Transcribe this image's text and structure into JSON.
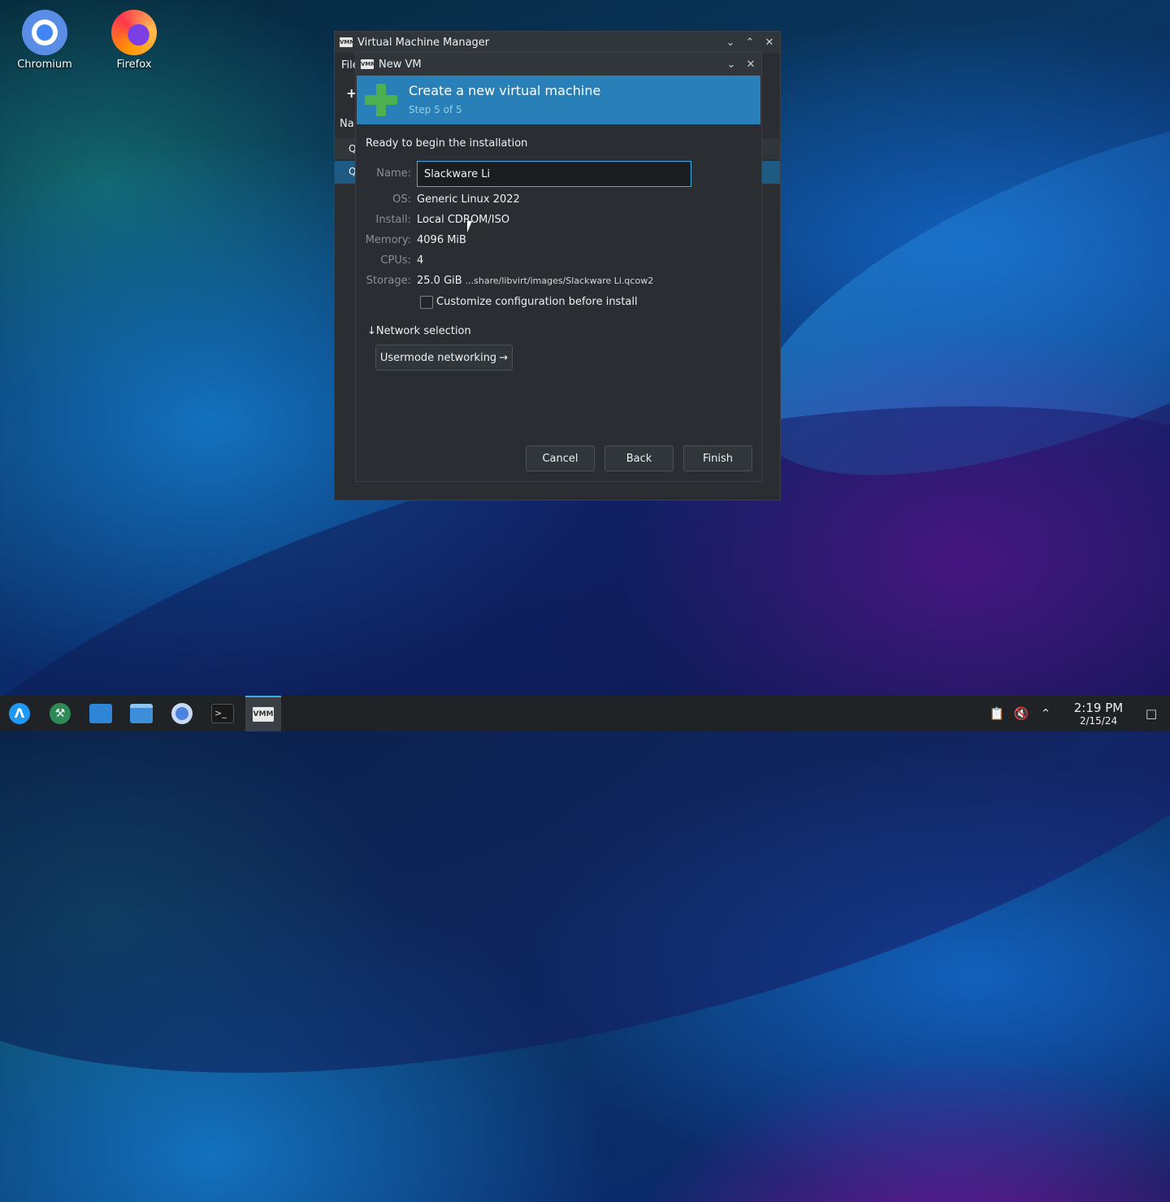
{
  "desktop": {
    "icons": [
      {
        "label": "Chromium"
      },
      {
        "label": "Firefox"
      }
    ]
  },
  "parent_window": {
    "title": "Virtual Machine Manager",
    "menu_fragment": "File",
    "column_fragment": "Na",
    "row_fragment": "Q"
  },
  "dialog": {
    "title": "New VM",
    "banner_title": "Create a new virtual machine",
    "banner_step": "Step 5 of 5",
    "ready_text": "Ready to begin the installation",
    "fields": {
      "name_label": "Name:",
      "name_value": "Slackware Li",
      "os_label": "OS:",
      "os_value": "Generic Linux 2022",
      "install_label": "Install:",
      "install_value": "Local CDROM/ISO",
      "memory_label": "Memory:",
      "memory_value": "4096 MiB",
      "cpus_label": "CPUs:",
      "cpus_value": "4",
      "storage_label": "Storage:",
      "storage_value": "25.0 GiB",
      "storage_path": "...share/libvirt/images/Slackware Li.qcow2"
    },
    "customize_label": "Customize configuration before install",
    "network_section": "Network selection",
    "network_button": "Usermode networking",
    "buttons": {
      "cancel": "Cancel",
      "back": "Back",
      "finish": "Finish"
    }
  },
  "taskbar": {
    "time": "2:19 PM",
    "date": "2/15/24"
  },
  "colors": {
    "accent": "#3daee9",
    "banner": "#2980b9",
    "window_bg": "#2a2e32",
    "taskbar_bg": "#202326"
  }
}
